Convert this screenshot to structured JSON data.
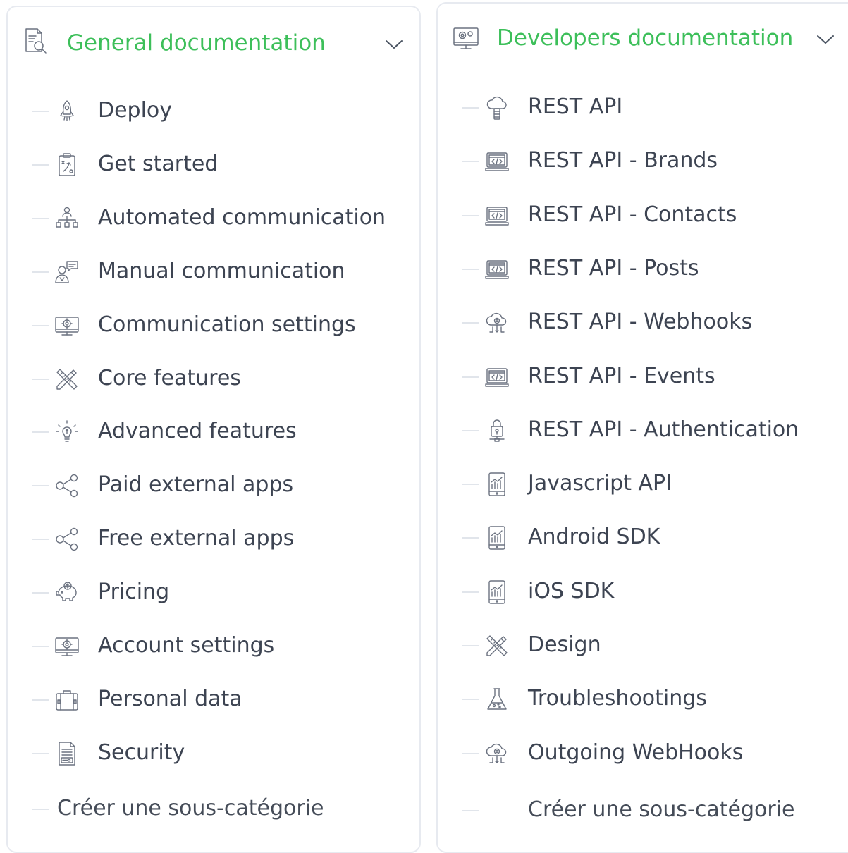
{
  "general": {
    "title": "General documentation",
    "header_icon": "document-search-icon",
    "items": [
      {
        "label": "Deploy",
        "icon": "rocket-icon"
      },
      {
        "label": "Get started",
        "icon": "clipboard-strategy-icon"
      },
      {
        "label": "Automated communication",
        "icon": "org-chart-icon"
      },
      {
        "label": "Manual communication",
        "icon": "person-chat-icon"
      },
      {
        "label": "Communication settings",
        "icon": "monitor-gear-icon"
      },
      {
        "label": "Core features",
        "icon": "pencil-ruler-icon"
      },
      {
        "label": "Advanced features",
        "icon": "lightbulb-icon"
      },
      {
        "label": "Paid external apps",
        "icon": "share-icon"
      },
      {
        "label": "Free external apps",
        "icon": "share-icon"
      },
      {
        "label": "Pricing",
        "icon": "piggy-bank-icon"
      },
      {
        "label": "Account settings",
        "icon": "monitor-gear-icon"
      },
      {
        "label": "Personal data",
        "icon": "briefcase-icon"
      },
      {
        "label": "Security",
        "icon": "document-key-icon"
      }
    ],
    "create_label": "Créer une sous-catégorie"
  },
  "developers": {
    "title": "Developers documentation",
    "header_icon": "monitor-gear-icon",
    "items": [
      {
        "label": "REST API",
        "icon": "cloud-server-icon"
      },
      {
        "label": "REST API - Brands",
        "icon": "code-laptop-icon"
      },
      {
        "label": "REST API - Contacts",
        "icon": "code-laptop-icon"
      },
      {
        "label": "REST API - Posts",
        "icon": "code-laptop-icon"
      },
      {
        "label": "REST API - Webhooks",
        "icon": "cloud-gear-icon"
      },
      {
        "label": "REST API - Events",
        "icon": "code-laptop-icon"
      },
      {
        "label": "REST API - Authentication",
        "icon": "lock-network-icon"
      },
      {
        "label": "Javascript API",
        "icon": "tablet-chart-icon"
      },
      {
        "label": "Android SDK",
        "icon": "tablet-chart-icon"
      },
      {
        "label": "iOS SDK",
        "icon": "tablet-chart-icon"
      },
      {
        "label": "Design",
        "icon": "pencil-ruler-icon"
      },
      {
        "label": "Troubleshootings",
        "icon": "flask-icon"
      },
      {
        "label": "Outgoing WebHooks",
        "icon": "cloud-gear-icon"
      }
    ],
    "create_label": "Créer une sous-catégorie"
  },
  "colors": {
    "accent": "#3dbf5a",
    "text": "#3d4452",
    "border": "#e7eaf0",
    "icon": "#6b7280"
  }
}
